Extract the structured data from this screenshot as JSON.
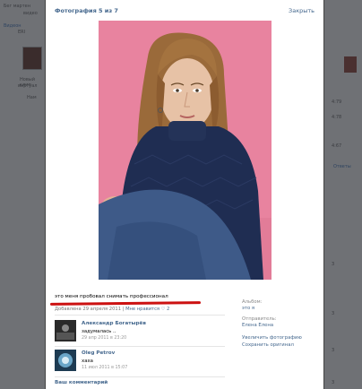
{
  "modal": {
    "title": "Фотография 5 из 7",
    "close_label": "Закрыть",
    "caption": "это меня пробовал снимать профессионал",
    "added_prefix": "Добавлена",
    "added_date": "29 апреля 2011",
    "separator": "|",
    "likes_label": "Мне нравится",
    "likes_count": "2",
    "album_label": "Альбом:",
    "album_value": "это я",
    "sender_label": "Отправитель:",
    "sender_value": "Елена Елена",
    "enlarge_label": "Увеличить фотографию",
    "save_label": "Сохранить оригинал",
    "your_comment_label": "Ваш комментарий"
  },
  "comments": [
    {
      "name": "Александр Богатырёв",
      "text": "задумалась ..",
      "date": "29 апр 2011 в 23:20"
    },
    {
      "name": "Oleg Petrov",
      "text": "хаха",
      "date": "11 июл 2011 в 15:07"
    }
  ],
  "background": {
    "left_texts": [
      "Бег мартен",
      "видео",
      "Видеон",
      "ERI",
      "Новый клип",
      "виртуал",
      "Нам"
    ],
    "right_texts": [
      "4:79",
      "4:78",
      "4:67",
      "Ответы",
      "3",
      "3",
      "3",
      "3"
    ]
  }
}
